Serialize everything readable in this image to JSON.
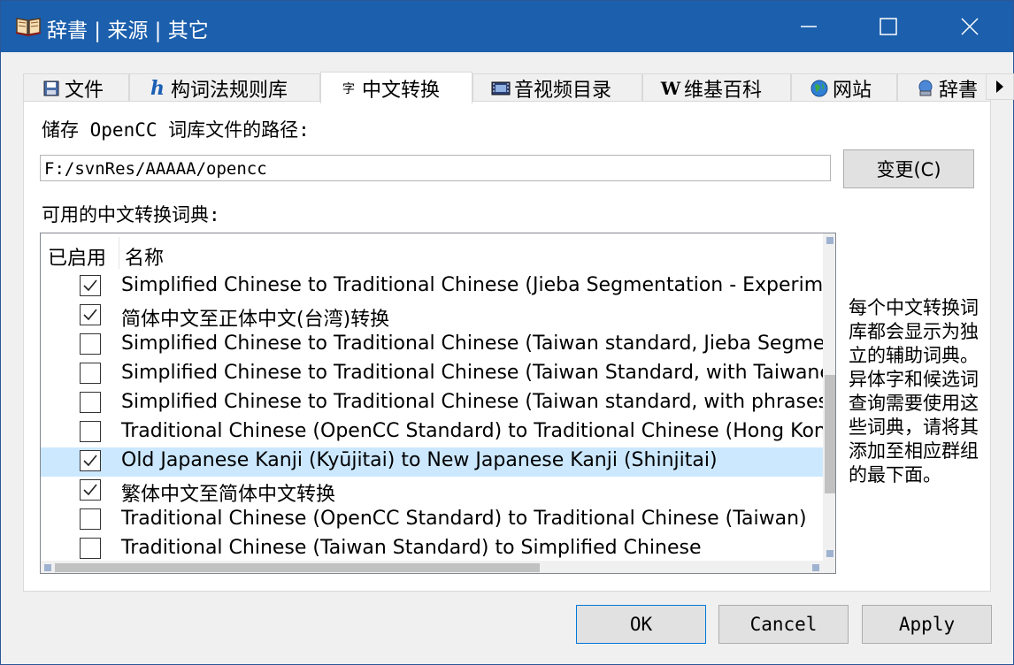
{
  "window": {
    "title": "辞書 | 来源 | 其它",
    "title_icon": "book-icon",
    "controls": [
      "minimize-icon",
      "maximize-icon",
      "close-icon"
    ],
    "colors": {
      "titlebar": "#1b5fad",
      "selection": "#cce8ff",
      "focus_border": "#0078d7"
    }
  },
  "tabs": [
    {
      "label": "文件",
      "icon": "floppy-disk-icon"
    },
    {
      "label": "构词法规则库",
      "icon": "h-letter-icon"
    },
    {
      "label": "中文转换",
      "icon": "zi-character-icon",
      "active": true
    },
    {
      "label": "音视频目录",
      "icon": "film-icon"
    },
    {
      "label": "维基百科",
      "icon": "wikipedia-w-icon"
    },
    {
      "label": "网站",
      "icon": "globe-icon"
    },
    {
      "label": "辞書",
      "icon": "dictionary-program-icon"
    }
  ],
  "panel": {
    "path_label": "储存 OpenCC 词库文件的路径:",
    "path_value": "F:/svnRes/AAAAA/opencc",
    "change_button": "变更(C)",
    "dict_label": "可用的中文转换词典:",
    "list_headers": {
      "enabled": "已启用",
      "name": "名称"
    },
    "rows": [
      {
        "checked": true,
        "name": "Simplified Chinese to Traditional Chinese (Jieba Segmentation - Experimental)"
      },
      {
        "checked": true,
        "name": "简体中文至正体中文(台湾)转换"
      },
      {
        "checked": false,
        "name": "Simplified Chinese to Traditional Chinese (Taiwan standard, Jieba Segmentation)"
      },
      {
        "checked": false,
        "name": "Simplified Chinese to Traditional Chinese (Taiwan Standard, with Taiwanese idiom)"
      },
      {
        "checked": false,
        "name": "Simplified Chinese to Traditional Chinese (Taiwan standard, with phrases)"
      },
      {
        "checked": false,
        "name": "Traditional Chinese (OpenCC Standard) to Traditional Chinese (Hong Kong)"
      },
      {
        "checked": true,
        "selected": true,
        "name": "Old Japanese Kanji (Kyūjitai) to New Japanese Kanji (Shinjitai)"
      },
      {
        "checked": true,
        "name": "繁体中文至简体中文转换"
      },
      {
        "checked": false,
        "name": "Traditional Chinese (OpenCC Standard) to Traditional Chinese (Taiwan)"
      },
      {
        "checked": false,
        "name": "Traditional Chinese (Taiwan Standard) to Simplified Chinese"
      }
    ],
    "note": "每个中文转换词库都会显示为独立的辅助词典。异体字和候选词查询需要使用这些词典，请将其添加至相应群组的最下面。"
  },
  "buttons": {
    "ok": "OK",
    "cancel": "Cancel",
    "apply": "Apply"
  }
}
